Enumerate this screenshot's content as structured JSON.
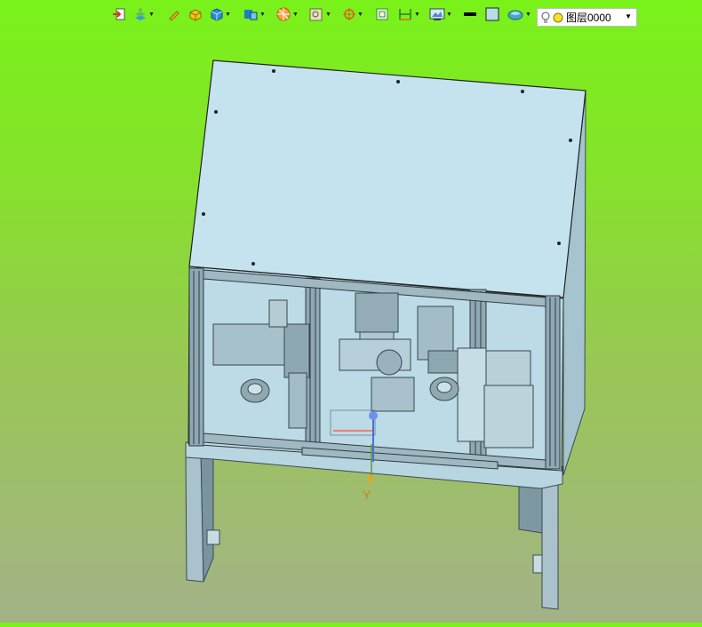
{
  "toolbar": {
    "layer_select": {
      "value": "图层0000"
    },
    "icons": [
      "import-icon",
      "layer-manager-icon",
      "pencil-icon",
      "box-solid-icon",
      "view-cube-icon",
      "display-mode-icon",
      "section-view-icon",
      "zoom-window-icon",
      "origin-icon",
      "frame-icon",
      "dimension-icon",
      "render-settings-icon",
      "line-color-icon",
      "fill-color-icon",
      "surface-style-icon",
      "light-bulb-icon"
    ],
    "colors": {
      "line_swatch": "#000000",
      "fill_swatch": "#b9dce8"
    }
  },
  "viewport": {
    "axis_label": "Y",
    "background_top": "#79f21a",
    "background_bottom": "#a3b287",
    "model_color": "#c2e2ee"
  }
}
